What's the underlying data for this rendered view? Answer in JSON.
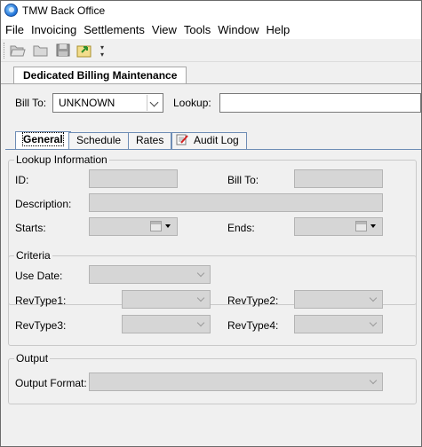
{
  "window": {
    "title": "TMW Back Office"
  },
  "menu": [
    "File",
    "Invoicing",
    "Settlements",
    "View",
    "Tools",
    "Window",
    "Help"
  ],
  "toolbar": {
    "buttons": [
      "open-folder-icon",
      "folder-icon",
      "save-icon",
      "export-icon"
    ]
  },
  "document_tab": "Dedicated Billing Maintenance",
  "header": {
    "bill_to_label": "Bill To:",
    "bill_to_value": "UNKNOWN",
    "lookup_label": "Lookup:",
    "lookup_value": ""
  },
  "tabs": [
    {
      "label": "General",
      "active": true
    },
    {
      "label": "Schedule",
      "active": false
    },
    {
      "label": "Rates",
      "active": false
    },
    {
      "label": "Audit Log",
      "active": false
    }
  ],
  "lookup_info": {
    "title": "Lookup Information",
    "id_label": "ID:",
    "bill_to_label": "Bill To:",
    "description_label": "Description:",
    "starts_label": "Starts:",
    "ends_label": "Ends:"
  },
  "criteria": {
    "title": "Criteria",
    "use_date_label": "Use Date:",
    "revtype1_label": "RevType1:",
    "revtype2_label": "RevType2:",
    "revtype3_label": "RevType3:",
    "revtype4_label": "RevType4:"
  },
  "output": {
    "title": "Output",
    "output_format_label": "Output Format:"
  }
}
